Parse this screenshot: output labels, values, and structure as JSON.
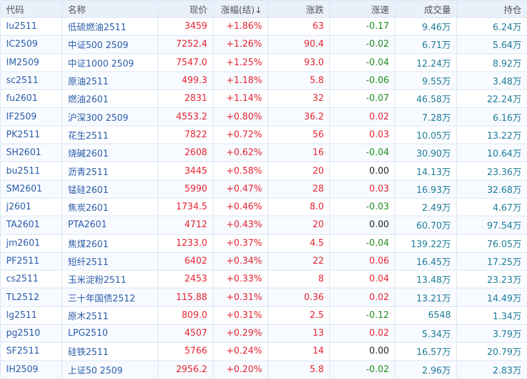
{
  "headers": [
    "代码",
    "名称",
    "现价",
    "涨幅(结)↓",
    "涨跌",
    "涨速",
    "成交量",
    "持仓"
  ],
  "colors": {
    "up": "#e32430",
    "down": "#1e8c1e",
    "volume": "#1d7b98",
    "link": "#2a5caa"
  },
  "rows": [
    [
      "lu2511",
      "低硫燃油2511",
      "3459",
      "+1.86%",
      "63",
      "-0.17",
      "9.46万",
      "6.24万"
    ],
    [
      "IC2509",
      "中证500 2509",
      "7252.4",
      "+1.26%",
      "90.4",
      "-0.02",
      "6.71万",
      "5.64万"
    ],
    [
      "IM2509",
      "中证1000 2509",
      "7547.0",
      "+1.25%",
      "93.0",
      "-0.04",
      "12.24万",
      "8.92万"
    ],
    [
      "sc2511",
      "原油2511",
      "499.3",
      "+1.18%",
      "5.8",
      "-0.06",
      "9.55万",
      "3.48万"
    ],
    [
      "fu2601",
      "燃油2601",
      "2831",
      "+1.14%",
      "32",
      "-0.07",
      "46.58万",
      "22.24万"
    ],
    [
      "IF2509",
      "沪深300 2509",
      "4553.2",
      "+0.80%",
      "36.2",
      "0.02",
      "7.28万",
      "6.16万"
    ],
    [
      "PK2511",
      "花生2511",
      "7822",
      "+0.72%",
      "56",
      "0.03",
      "10.05万",
      "13.22万"
    ],
    [
      "SH2601",
      "烧碱2601",
      "2608",
      "+0.62%",
      "16",
      "-0.04",
      "30.90万",
      "10.64万"
    ],
    [
      "bu2511",
      "沥青2511",
      "3445",
      "+0.58%",
      "20",
      "0.00",
      "14.13万",
      "23.36万"
    ],
    [
      "SM2601",
      "锰硅2601",
      "5990",
      "+0.47%",
      "28",
      "0.03",
      "16.93万",
      "32.68万"
    ],
    [
      "j2601",
      "焦炭2601",
      "1734.5",
      "+0.46%",
      "8.0",
      "-0.03",
      "2.49万",
      "4.67万"
    ],
    [
      "TA2601",
      "PTA2601",
      "4712",
      "+0.43%",
      "20",
      "0.00",
      "60.70万",
      "97.54万"
    ],
    [
      "jm2601",
      "焦煤2601",
      "1233.0",
      "+0.37%",
      "4.5",
      "-0.04",
      "139.22万",
      "76.05万"
    ],
    [
      "PF2511",
      "短纤2511",
      "6402",
      "+0.34%",
      "22",
      "0.06",
      "16.45万",
      "17.25万"
    ],
    [
      "cs2511",
      "玉米淀粉2511",
      "2453",
      "+0.33%",
      "8",
      "0.04",
      "13.48万",
      "23.23万"
    ],
    [
      "TL2512",
      "三十年国债2512",
      "115.88",
      "+0.31%",
      "0.36",
      "0.02",
      "13.21万",
      "14.49万"
    ],
    [
      "lg2511",
      "原木2511",
      "809.0",
      "+0.31%",
      "2.5",
      "-0.12",
      "6548",
      "1.34万"
    ],
    [
      "pg2510",
      "LPG2510",
      "4507",
      "+0.29%",
      "13",
      "0.02",
      "5.34万",
      "3.79万"
    ],
    [
      "SF2511",
      "硅铁2511",
      "5766",
      "+0.24%",
      "14",
      "0.00",
      "16.57万",
      "20.79万"
    ],
    [
      "IH2509",
      "上证50 2509",
      "2956.2",
      "+0.20%",
      "5.8",
      "-0.02",
      "2.96万",
      "2.83万"
    ]
  ]
}
